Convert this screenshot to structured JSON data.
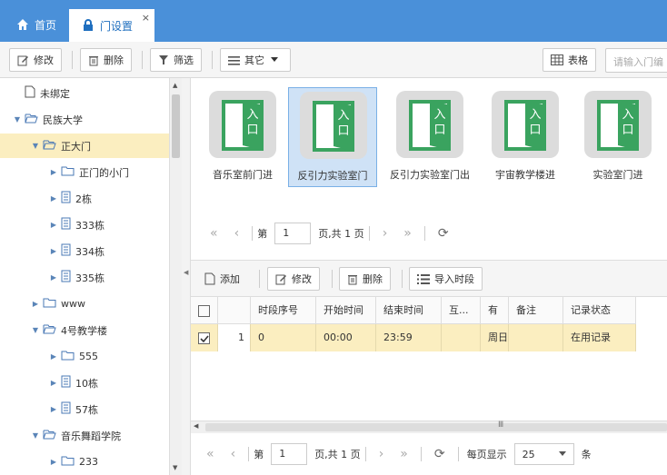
{
  "tabs": {
    "home": "首页",
    "active": "门设置",
    "close": "×"
  },
  "toolbar": {
    "edit": "修改",
    "delete": "删除",
    "filter": "筛选",
    "other": "其它",
    "table": "表格",
    "search_placeholder": "请输入门编"
  },
  "tree": [
    {
      "label": "未绑定",
      "indent": 0,
      "expand": "none",
      "icon": "file-icon"
    },
    {
      "label": "民族大学",
      "indent": 0,
      "expand": "open",
      "icon": "folder-open-icon"
    },
    {
      "label": "正大门",
      "indent": 1,
      "expand": "open",
      "icon": "folder-open-icon",
      "selected": true
    },
    {
      "label": "正门的小门",
      "indent": 2,
      "expand": "closed",
      "icon": "folder-icon"
    },
    {
      "label": "2栋",
      "indent": 2,
      "expand": "closed",
      "icon": "building-icon"
    },
    {
      "label": "333栋",
      "indent": 2,
      "expand": "closed",
      "icon": "building-icon"
    },
    {
      "label": "334栋",
      "indent": 2,
      "expand": "closed",
      "icon": "building-icon"
    },
    {
      "label": "335栋",
      "indent": 2,
      "expand": "closed",
      "icon": "building-icon"
    },
    {
      "label": "www",
      "indent": 1,
      "expand": "closed",
      "icon": "folder-icon"
    },
    {
      "label": "4号教学楼",
      "indent": 1,
      "expand": "open",
      "icon": "folder-open-icon"
    },
    {
      "label": "555",
      "indent": 2,
      "expand": "closed",
      "icon": "folder-icon"
    },
    {
      "label": "10栋",
      "indent": 2,
      "expand": "closed",
      "icon": "building-icon"
    },
    {
      "label": "57栋",
      "indent": 2,
      "expand": "closed",
      "icon": "building-icon"
    },
    {
      "label": "音乐舞蹈学院",
      "indent": 1,
      "expand": "open",
      "icon": "folder-open-icon"
    },
    {
      "label": "233",
      "indent": 2,
      "expand": "closed",
      "icon": "folder-icon"
    }
  ],
  "doors": [
    {
      "label": "音乐室前门进",
      "door_text": "入口",
      "selected": false
    },
    {
      "label": "反引力实验室门",
      "door_text": "入口",
      "selected": true
    },
    {
      "label": "反引力实验室门出",
      "door_text": "入口",
      "selected": false
    },
    {
      "label": "宇宙教学楼进",
      "door_text": "入口",
      "selected": false
    },
    {
      "label": "实验室门进",
      "door_text": "入口",
      "selected": false
    }
  ],
  "pager_top": {
    "first": "«",
    "prev": "‹",
    "page_prefix": "第",
    "page_value": "1",
    "page_suffix": "页,共 1 页",
    "next": "›",
    "last": "»",
    "refresh": "⟳"
  },
  "bottom_toolbar": {
    "add": "添加",
    "edit": "修改",
    "delete": "删除",
    "import": "导入时段"
  },
  "grid": {
    "headers": [
      "时段序号",
      "开始时间",
      "结束时间",
      "互...",
      "有",
      "备注",
      "记录状态"
    ],
    "row": {
      "num": "1",
      "cells": [
        "0",
        "00:00",
        "23:59",
        "",
        "周日,",
        "",
        "在用记录"
      ]
    }
  },
  "hscroll_thumb": "Ⅲ",
  "pager_bottom": {
    "first": "«",
    "prev": "‹",
    "page_prefix": "第",
    "page_value": "1",
    "page_suffix": "页,共 1 页",
    "next": "›",
    "last": "»",
    "refresh": "⟳",
    "per_page_label": "每页显示",
    "per_page_value": "25",
    "per_page_unit": "条"
  },
  "colors": {
    "tabbar": "#4a90d9",
    "door_green": "#3aa35f",
    "selected_row": "#fbeec0"
  }
}
